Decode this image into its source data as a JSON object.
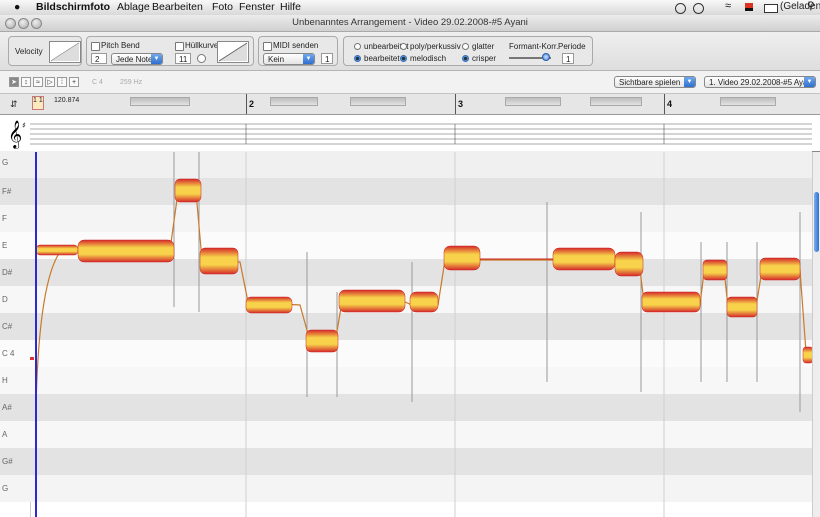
{
  "menubar": {
    "apple": "",
    "app": "Bildschirmfoto",
    "items": [
      "Ablage",
      "Bearbeiten",
      "Foto",
      "Fenster",
      "Hilfe"
    ],
    "battery_label": "(Geladen)"
  },
  "window": {
    "title": "Unbenanntes Arrangement - Video 29.02.2008-#5 Ayani"
  },
  "toolbar": {
    "velocity_label": "Velocity",
    "pitchbend_label": "Pitch Bend",
    "pitchbend_value": "2",
    "pitchbend_mode": "Jede Note",
    "huellkurve_label": "Hüllkurve",
    "huellkurve_value": "11",
    "midi_label": "MIDI senden",
    "midi_select": "Kein",
    "midi_channel": "1",
    "radio_unbearbeitet": "unbearbeitet",
    "radio_poly": "poly/perkussiv",
    "radio_glatter": "glatter",
    "radio_bearbeitet": "bearbeitet",
    "radio_melodisch": "melodisch",
    "radio_crisper": "crisper",
    "formant_label": "Formant-Korr.",
    "periode_label": "Periode",
    "periode_value": "1"
  },
  "toolrow": {
    "note_readout": "C 4",
    "freq_readout": "259 Hz",
    "play_mode": "Sichtbare spielen",
    "track_select": "1. Video 29.02.2008-#5 Ayani"
  },
  "ruler": {
    "position": "1 1",
    "tempo": "120.874",
    "bars": [
      "2",
      "3",
      "4"
    ]
  },
  "pitch_rows": [
    "G",
    "F#",
    "F",
    "E",
    "D#",
    "D",
    "C#",
    "C 4",
    "H",
    "A#",
    "A",
    "G#",
    "G"
  ],
  "colors": {
    "blob_outer": "#d42a2a",
    "blob_inner": "#f7d24a",
    "pitch_line": "#c87a2a",
    "playhead": "#2a2ad0"
  },
  "icons": [
    "apple-icon",
    "wifi-icon",
    "clock-icon",
    "search-icon",
    "arrow-tool-icon",
    "pitch-tool-icon",
    "scissors-tool-icon",
    "zoom-icon"
  ]
}
